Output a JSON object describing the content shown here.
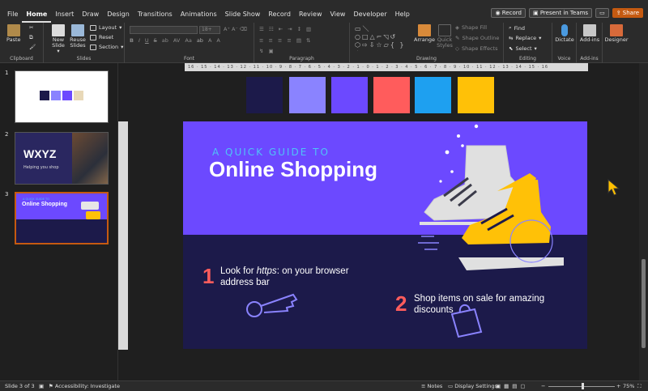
{
  "menu": {
    "tabs": [
      "File",
      "Home",
      "Insert",
      "Draw",
      "Design",
      "Transitions",
      "Animations",
      "Slide Show",
      "Record",
      "Review",
      "View",
      "Developer",
      "Help"
    ],
    "record_label": "Record",
    "present_label": "Present in Teams",
    "share_label": "Share"
  },
  "ribbon": {
    "paste": "Paste",
    "new_slide": "New Slide",
    "new_slide_caret": "▾",
    "reuse_slides": "Reuse Slides",
    "layout": "Layout",
    "reset": "Reset",
    "section": "Section",
    "font_size": "18+",
    "shape_fill": "Shape Fill",
    "shape_outline": "Shape Outline",
    "shape_effects": "Shape Effects",
    "arrange": "Arrange",
    "quick_styles": "Quick Styles",
    "find": "Find",
    "replace": "Replace",
    "select": "Select",
    "dictate": "Dictate",
    "add_ins": "Add-ins",
    "designer": "Designer",
    "groups": {
      "clipboard": "Clipboard",
      "slides": "Slides",
      "font": "Font",
      "paragraph": "Paragraph",
      "drawing": "Drawing",
      "editing": "Editing",
      "voice": "Voice",
      "add_ins": "Add-ins"
    }
  },
  "ruler": {
    "marks": "16 · 15 · 14 · 13 · 12 · 11 · 10 · 9 · 8 · 7 · 6 · 5 · 4 · 3 · 2 · 1 · 0 · 1 · 2 · 3 · 4 · 5 · 6 · 7 · 8 · 9 · 10 · 11 · 12 · 13 · 14 · 15 · 16"
  },
  "thumbnails": [
    {
      "number": "1"
    },
    {
      "number": "2",
      "title": "WXYZ",
      "tagline": "Helping you shop"
    },
    {
      "number": "3",
      "title": "Online Shopping",
      "sub": "A Quick Guide to"
    }
  ],
  "swatch_colors": [
    "#1c1a4a",
    "#8a83ff",
    "#6c49ff",
    "#ff5c5c",
    "#1ea0f0",
    "#ffc107"
  ],
  "slide": {
    "subtitle": "A QUICK GUIDE TO",
    "title": "Online Shopping",
    "item1_number": "1",
    "item1_line1_pre": "Look for ",
    "item1_line1_em": "https",
    "item1_line1_post": ": on your browser",
    "item1_line2": "address bar",
    "item2_number": "2",
    "item2_line1": "Shop items on sale for amazing",
    "item2_line2": "discounts",
    "accent_bg": "#6c49ff",
    "dark_bg": "#1c1a4a"
  },
  "status": {
    "slide_counter": "Slide 3 of 3",
    "accessibility": "Accessibility: Investigate",
    "notes": "Notes",
    "display_settings": "Display Settings",
    "zoom": "75%"
  }
}
